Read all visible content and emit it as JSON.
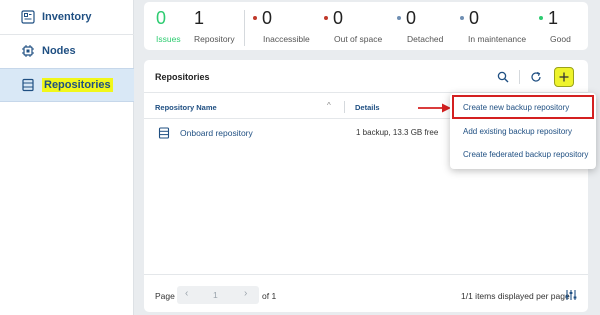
{
  "sidebar": {
    "items": [
      {
        "label": "Inventory",
        "icon": "inventory-icon",
        "active": false
      },
      {
        "label": "Nodes",
        "icon": "nodes-icon",
        "active": false
      },
      {
        "label": "Repositories",
        "icon": "repositories-icon",
        "active": true
      }
    ]
  },
  "stats": {
    "issues": {
      "value": "0",
      "label": "Issues"
    },
    "repository": {
      "value": "1",
      "label": "Repository"
    },
    "inaccessible": {
      "value": "0",
      "label": "Inaccessible",
      "dot_color": "#c0392b"
    },
    "out_of_space": {
      "value": "0",
      "label": "Out of space",
      "dot_color": "#c0392b"
    },
    "detached": {
      "value": "0",
      "label": "Detached",
      "dot_color": "#6f8fb3"
    },
    "in_maintenance": {
      "value": "0",
      "label": "In maintenance",
      "dot_color": "#6f8fb3"
    },
    "good": {
      "value": "1",
      "label": "Good",
      "dot_color": "#2ecc71"
    }
  },
  "panel": {
    "title": "Repositories",
    "columns": {
      "name": "Repository Name",
      "details": "Details"
    },
    "rows": [
      {
        "name": "Onboard repository",
        "details": "1 backup, 13.3 GB free"
      }
    ],
    "footer": {
      "page_label": "Page",
      "current_page": "1",
      "of_label": "of 1",
      "items_label": "1/1 items displayed per page"
    }
  },
  "menu": {
    "items": [
      {
        "label": "Create new backup repository",
        "highlighted": true
      },
      {
        "label": "Add existing backup repository",
        "highlighted": false
      },
      {
        "label": "Create federated backup repository",
        "highlighted": false
      }
    ]
  },
  "colors": {
    "accent": "#1f4f82",
    "issues_green": "#2ecc71",
    "add_button": "#eef32b",
    "highlight_red": "#d42020"
  }
}
